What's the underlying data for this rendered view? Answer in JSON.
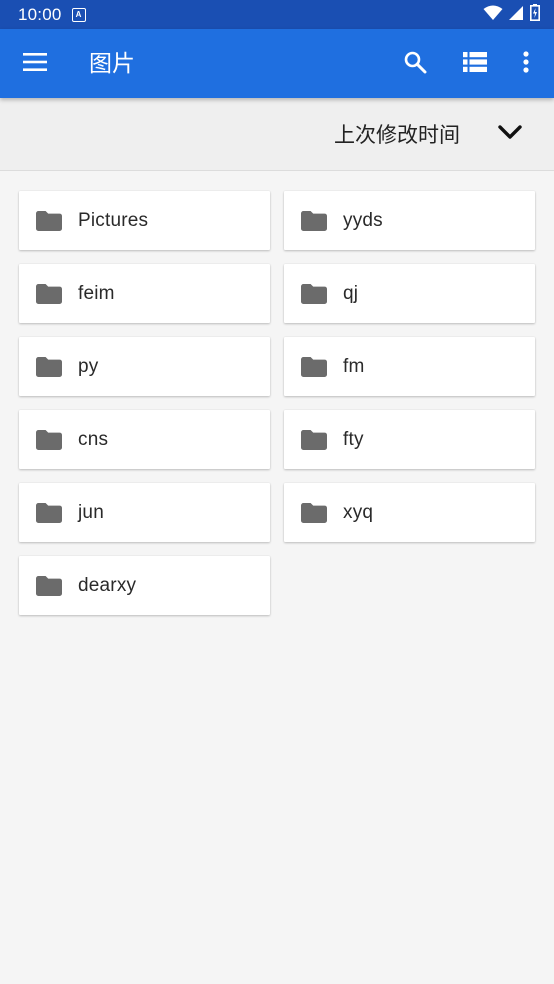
{
  "status_bar": {
    "time": "10:00",
    "notification_letter": "A",
    "icons": [
      "wifi-icon",
      "signal-icon",
      "battery-icon"
    ]
  },
  "app_bar": {
    "title": "图片",
    "icons": [
      "menu-icon",
      "search-icon",
      "list-view-icon",
      "more-vert-icon"
    ],
    "color": "#1f6fe0"
  },
  "sort": {
    "label": "上次修改时间",
    "icon": "chevron-down-icon"
  },
  "folders": [
    {
      "name": "Pictures",
      "icon": "folder-icon"
    },
    {
      "name": "yyds",
      "icon": "folder-icon"
    },
    {
      "name": "feim",
      "icon": "folder-icon"
    },
    {
      "name": "qj",
      "icon": "folder-icon"
    },
    {
      "name": "py",
      "icon": "folder-icon"
    },
    {
      "name": "fm",
      "icon": "folder-icon"
    },
    {
      "name": "cns",
      "icon": "folder-icon"
    },
    {
      "name": "fty",
      "icon": "folder-icon"
    },
    {
      "name": "jun",
      "icon": "folder-icon"
    },
    {
      "name": "xyq",
      "icon": "folder-icon"
    },
    {
      "name": "dearxy",
      "icon": "folder-icon"
    }
  ]
}
